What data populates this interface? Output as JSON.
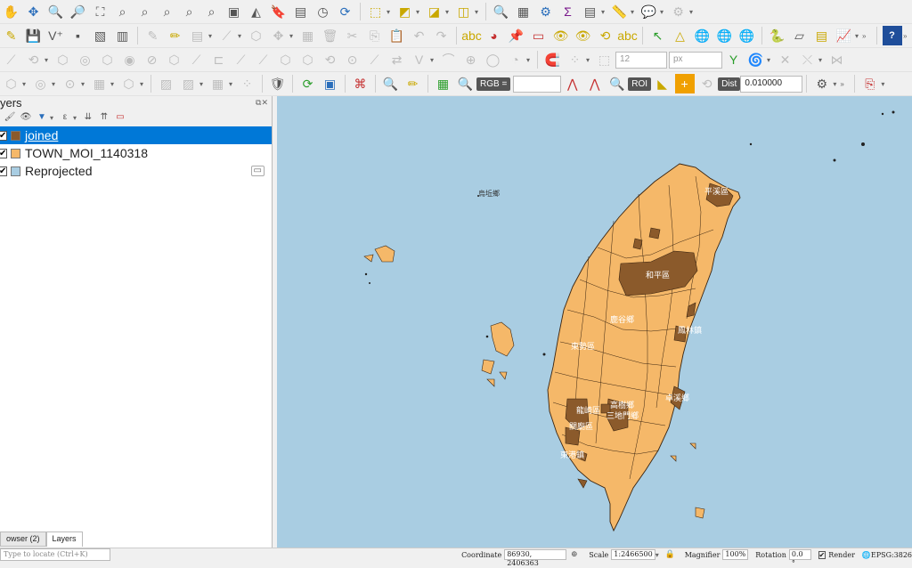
{
  "colors": {
    "selection": "#0078d7",
    "joined_fill": "#8b5a2b",
    "town_fill": "#f5b869",
    "reprojected_fill": "#a9cde2",
    "ocean": "#a9cde2"
  },
  "layers_panel": {
    "title": "yers",
    "items": [
      {
        "name": "joined",
        "checked": true,
        "selected": true,
        "color": "#8b5a2b"
      },
      {
        "name": "TOWN_MOI_1140318",
        "checked": true,
        "selected": false,
        "color": "#f5b869"
      },
      {
        "name": "Reprojected",
        "checked": true,
        "selected": false,
        "color": "#a9cde2"
      }
    ]
  },
  "toolbar": {
    "size_value": "12",
    "size_unit": "px",
    "rgb_label": "RGB =",
    "roi_label": "ROI",
    "dist_label": "Dist",
    "dist_value": "0.010000"
  },
  "map": {
    "labels": [
      "烏坵鄉",
      "平溪區",
      "和平區",
      "鹿谷鄉",
      "鳳林鎮",
      "東勢區",
      "卓溪鄉",
      "龍崎區",
      "高樹鄉",
      "三地門鄉",
      "關廟區",
      "東港鎮"
    ]
  },
  "bottom_tabs": [
    "owser (2)",
    "Layers"
  ],
  "status": {
    "locator_placeholder": "Type to locate (Ctrl+K)",
    "coordinate_label": "Coordinate",
    "coordinate_value": "86930, 2406363",
    "scale_label": "Scale",
    "scale_value": "1:2466500",
    "magnifier_label": "Magnifier",
    "magnifier_value": "100%",
    "rotation_label": "Rotation",
    "rotation_value": "0.0 °",
    "render_label": "Render",
    "crs_label": "EPSG:3826"
  }
}
